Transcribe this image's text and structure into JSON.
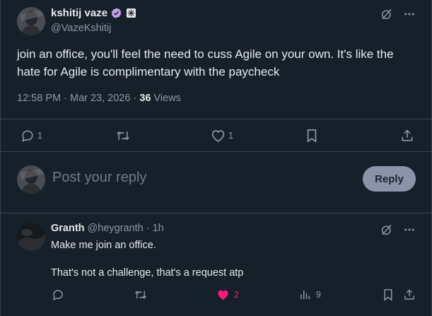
{
  "tweet": {
    "author_name": "kshitij vaze",
    "author_handle": "@VazeKshitij",
    "text": "join an office, you'll feel the need to cuss Agile on your own. It's like the hate for Agile is complimentary with the paycheck",
    "time": "12:58 PM",
    "date": "Mar 23, 2026",
    "views_count": "36",
    "views_label": "Views",
    "sep": "·",
    "replies": "1",
    "reposts": "",
    "likes": "1",
    "icons": [
      "grok-icon",
      "more-icon",
      "reply-icon",
      "repost-icon",
      "like-icon",
      "bookmark-icon",
      "share-icon"
    ]
  },
  "composer": {
    "placeholder": "Post your reply",
    "button_label": "Reply"
  },
  "reply": {
    "author_name": "Granth",
    "author_handle": "@heygranth",
    "time_ago": "1h",
    "sep": "·",
    "line1": "Make me join an office.",
    "line2": "That's not a challenge, that's a request atp",
    "replies": "",
    "reposts": "",
    "likes": "2",
    "views": "9"
  },
  "colors": {
    "background": "#15202b",
    "border": "#38444d",
    "text": "#e7e9ea",
    "muted": "#8b98a5",
    "like_active": "#f91880",
    "verified": "#c9a3e8",
    "reply_button": "#8a93a8"
  }
}
